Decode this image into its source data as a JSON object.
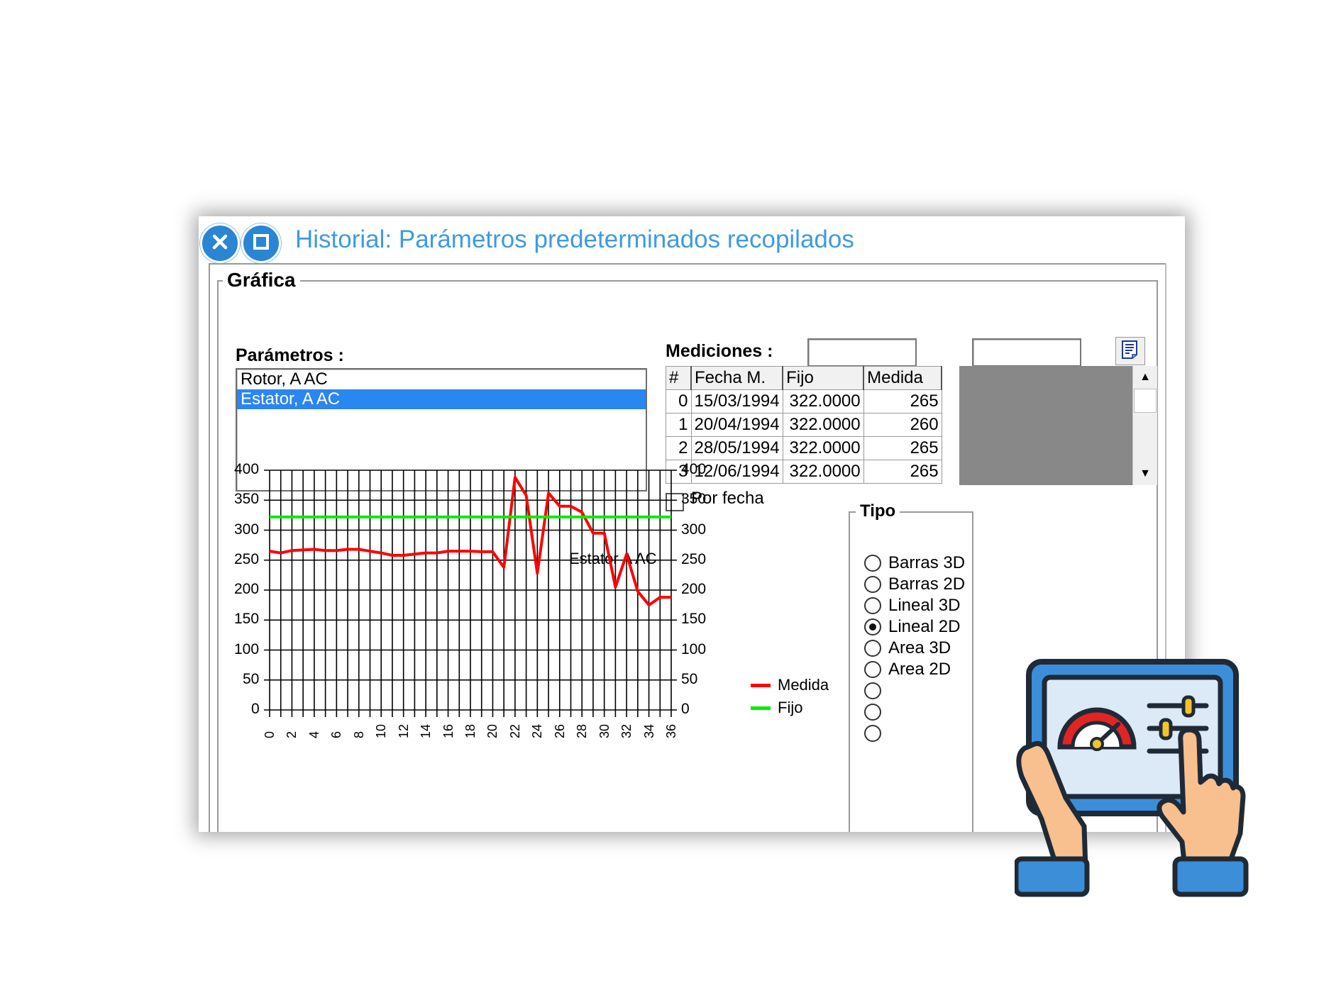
{
  "window": {
    "title": "Historial: Parámetros predeterminados recopilados",
    "close_icon": "close-icon",
    "maximize_icon": "maximize-icon"
  },
  "grafica_group": {
    "legend": "Gráfica",
    "parametros_label": "Parámetros :",
    "parametros": [
      {
        "label": "Rotor, A AC",
        "selected": false
      },
      {
        "label": "Estator, A AC",
        "selected": true
      }
    ],
    "mediciones_label": "Mediciones :",
    "mediciones_field_1": "",
    "mediciones_field_2": "",
    "report_icon": "report-icon",
    "table": {
      "columns": [
        "#",
        "Fecha M.",
        "Fijo",
        "Medida"
      ],
      "rows": [
        [
          "0",
          "15/03/1994",
          "322.0000",
          "265"
        ],
        [
          "1",
          "20/04/1994",
          "322.0000",
          "260"
        ],
        [
          "2",
          "28/05/1994",
          "322.0000",
          "265"
        ],
        [
          "3",
          "12/06/1994",
          "322.0000",
          "265"
        ]
      ]
    },
    "por_fecha_label": "Por fecha",
    "por_fecha_checked": false
  },
  "tipo_group": {
    "legend": "Tipo",
    "options": [
      {
        "label": "Barras 3D",
        "selected": false
      },
      {
        "label": "Barras 2D",
        "selected": false
      },
      {
        "label": "Lineal 3D",
        "selected": false
      },
      {
        "label": "Lineal 2D",
        "selected": true
      },
      {
        "label": "Area 3D",
        "selected": false
      },
      {
        "label": "Area 2D",
        "selected": false
      }
    ]
  },
  "chart_data": {
    "type": "line",
    "title": "Estator A AC",
    "xlabel": "",
    "ylabel": "",
    "ylim": [
      0,
      400
    ],
    "yticks": [
      0,
      50,
      100,
      150,
      200,
      250,
      300,
      350,
      400
    ],
    "x_tick_labels": [
      "0",
      "2",
      "4",
      "6",
      "8",
      "10",
      "12",
      "14",
      "16",
      "18",
      "20",
      "22",
      "24",
      "26",
      "28",
      "30",
      "32",
      "34",
      "36"
    ],
    "xlim": [
      0,
      36
    ],
    "grid": true,
    "legend_position": "right",
    "series": [
      {
        "name": "Medida",
        "color": "#ff0000",
        "x": [
          0,
          1,
          2,
          3,
          4,
          5,
          6,
          7,
          8,
          9,
          10,
          11,
          12,
          13,
          14,
          15,
          16,
          17,
          18,
          19,
          20,
          21,
          22,
          23,
          24,
          25,
          26,
          27,
          28,
          29,
          30,
          31,
          32,
          33,
          34,
          35,
          36
        ],
        "values": [
          265,
          262,
          266,
          267,
          268,
          266,
          266,
          268,
          268,
          265,
          262,
          258,
          258,
          260,
          262,
          262,
          265,
          265,
          265,
          264,
          264,
          238,
          388,
          358,
          228,
          362,
          340,
          340,
          330,
          295,
          295,
          205,
          260,
          198,
          175,
          188,
          188
        ]
      },
      {
        "name": "Fijo",
        "color": "#00ee00",
        "x": [
          0,
          36
        ],
        "values": [
          322,
          322
        ]
      }
    ]
  },
  "decoration": {
    "icon": "tablet-dashboard-hands-icon"
  }
}
